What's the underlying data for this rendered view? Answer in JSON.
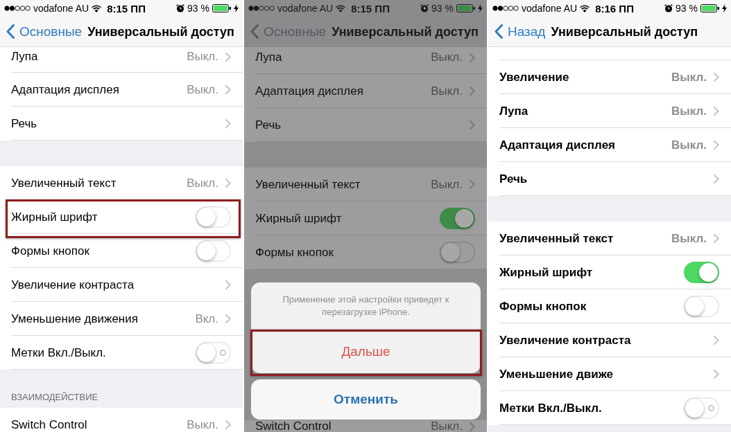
{
  "screens": [
    {
      "dimmed": false,
      "bold_text": false,
      "status_bar": {
        "carrier": "vodafone AU",
        "time": "8:15 ПП",
        "battery": "93 %"
      },
      "nav_bar": {
        "back": "Основные",
        "title": "Универсальный доступ"
      },
      "groups": [
        {
          "rows": [
            {
              "kind": "link",
              "label": "Лупа",
              "value": "Выкл.",
              "highlighted": false
            },
            {
              "kind": "link",
              "label": "Адаптация дисплея",
              "value": "Выкл.",
              "highlighted": false
            },
            {
              "kind": "link",
              "label": "Речь",
              "highlighted": false
            }
          ]
        },
        {
          "rows": [
            {
              "kind": "link",
              "label": "Увеличенный текст",
              "value": "Выкл.",
              "highlighted": false
            },
            {
              "kind": "toggle",
              "label": "Жирный шрифт",
              "on": false,
              "on_off_label": false,
              "highlighted": true
            },
            {
              "kind": "toggle",
              "label": "Формы кнопок",
              "on": false,
              "on_off_label": false,
              "highlighted": false
            },
            {
              "kind": "link",
              "label": "Увеличение контраста",
              "highlighted": false
            },
            {
              "kind": "link",
              "label": "Уменьшение движения",
              "value": "Вкл.",
              "highlighted": false
            },
            {
              "kind": "toggle",
              "label": "Метки Вкл./Выкл.",
              "on": false,
              "on_off_label": true,
              "highlighted": false
            }
          ]
        },
        {
          "header": "ВЗАИМОДЕЙСТВИЕ",
          "rows": [
            {
              "kind": "link",
              "label": "Switch Control",
              "value": "Выкл.",
              "highlighted": false
            }
          ]
        }
      ]
    },
    {
      "dimmed": true,
      "bold_text": false,
      "status_bar": {
        "carrier": "vodafone AU",
        "time": "8:15 ПП",
        "battery": "93 %"
      },
      "nav_bar": {
        "back": "Основные",
        "title": "Универсальный доступ"
      },
      "groups": [
        {
          "rows": [
            {
              "kind": "link",
              "label": "Лупа",
              "value": "Выкл.",
              "highlighted": false
            },
            {
              "kind": "link",
              "label": "Адаптация дисплея",
              "value": "Выкл.",
              "highlighted": false
            },
            {
              "kind": "link",
              "label": "Речь",
              "highlighted": false
            }
          ]
        },
        {
          "rows": [
            {
              "kind": "link",
              "label": "Увеличенный текст",
              "value": "Выкл.",
              "highlighted": false
            },
            {
              "kind": "toggle",
              "label": "Жирный шрифт",
              "on": true,
              "on_off_label": false,
              "highlighted": false
            },
            {
              "kind": "toggle",
              "label": "Формы кнопок",
              "on": false,
              "on_off_label": false,
              "highlighted": false
            }
          ]
        },
        {
          "rows": [
            {
              "kind": "link",
              "label": "Switch Control",
              "value": "Выкл.",
              "highlighted": false
            }
          ]
        }
      ],
      "sheet": {
        "message": "Применение этой настройки приведет к перезагрузке iPhone.",
        "actions": [
          {
            "kind": "destructive",
            "label": "Дальше",
            "highlighted": true
          }
        ],
        "cancel": "Отменить"
      }
    },
    {
      "dimmed": false,
      "bold_text": true,
      "status_bar": {
        "carrier": "vodafone AU",
        "time": "8:16 ПП",
        "battery": "93 %"
      },
      "nav_bar": {
        "back": "Назад",
        "title": "Универсальный доступ"
      },
      "groups": [
        {
          "rows": [
            {
              "kind": "link",
              "label": "Увеличение",
              "value": "Выкл.",
              "highlighted": false
            },
            {
              "kind": "link",
              "label": "Лупа",
              "value": "Выкл.",
              "highlighted": false
            },
            {
              "kind": "link",
              "label": "Адаптация дисплея",
              "value": "Выкл.",
              "highlighted": false
            },
            {
              "kind": "link",
              "label": "Речь",
              "highlighted": false
            }
          ]
        },
        {
          "rows": [
            {
              "kind": "link",
              "label": "Увеличенный текст",
              "value": "Выкл.",
              "highlighted": false
            },
            {
              "kind": "toggle",
              "label": "Жирный шрифт",
              "on": true,
              "on_off_label": false,
              "highlighted": false
            },
            {
              "kind": "toggle",
              "label": "Формы кнопок",
              "on": false,
              "on_off_label": false,
              "highlighted": false
            },
            {
              "kind": "link",
              "label": "Увеличение контраста",
              "highlighted": false
            },
            {
              "kind": "link",
              "label": "Уменьшение движе",
              "highlighted": false
            },
            {
              "kind": "toggle",
              "label": "Метки Вкл./Выкл.",
              "on": false,
              "on_off_label": true,
              "highlighted": false
            }
          ]
        }
      ]
    }
  ]
}
